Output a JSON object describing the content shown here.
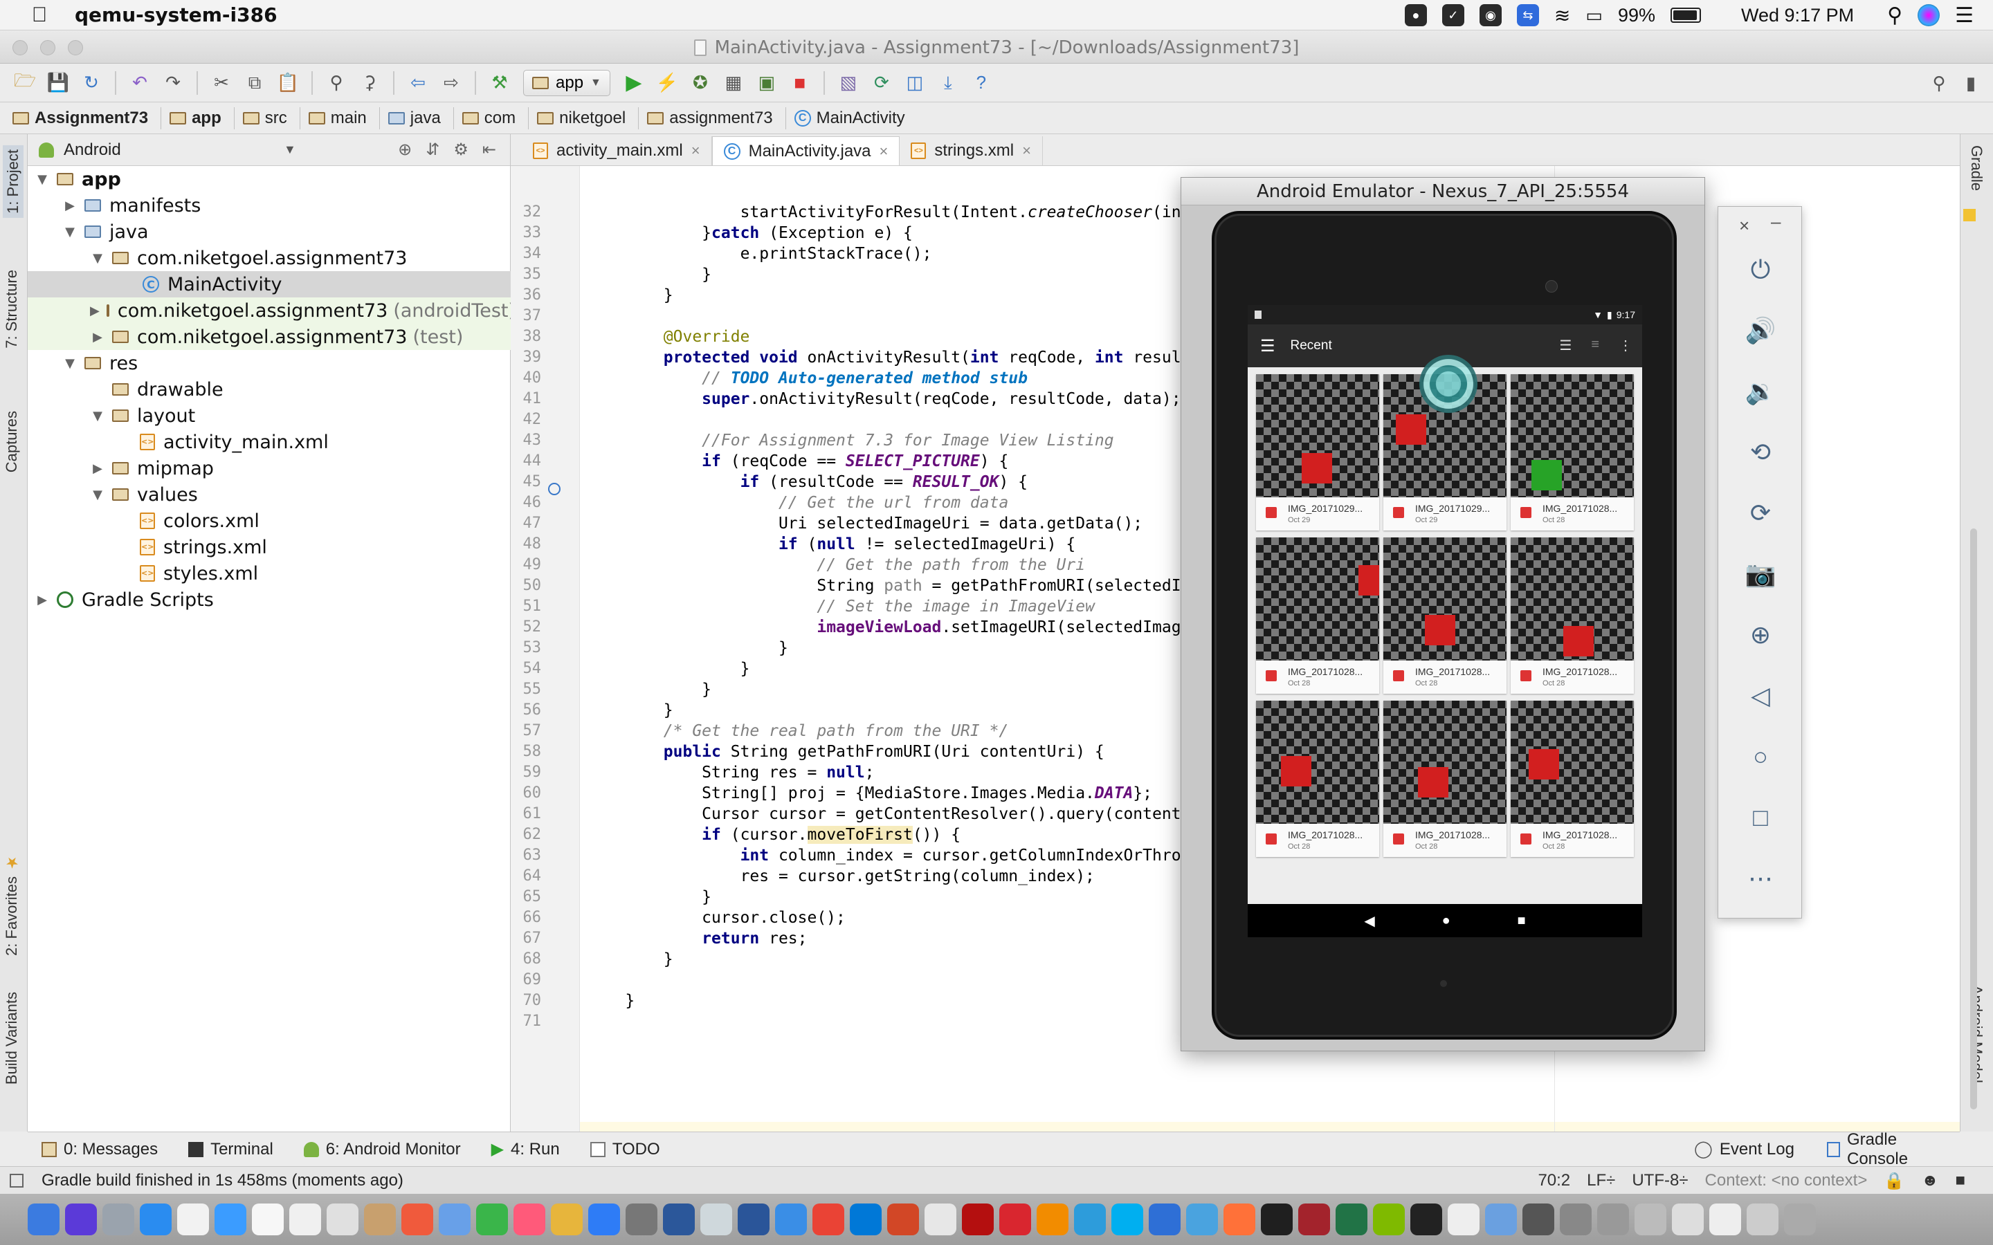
{
  "menubar": {
    "app_name": "qemu-system-i386",
    "battery": "99%",
    "clock": "Wed 9:17 PM"
  },
  "window": {
    "title": "MainActivity.java - Assignment73 - [~/Downloads/Assignment73]"
  },
  "toolbar": {
    "run_config": "app"
  },
  "breadcrumb": [
    "Assignment73",
    "app",
    "src",
    "main",
    "java",
    "com",
    "niketgoel",
    "assignment73",
    "MainActivity"
  ],
  "project": {
    "view": "Android",
    "tree": [
      {
        "label": "app",
        "suffix": ""
      },
      {
        "label": "manifests",
        "suffix": ""
      },
      {
        "label": "java",
        "suffix": ""
      },
      {
        "label": "com.niketgoel.assignment73",
        "suffix": ""
      },
      {
        "label": "MainActivity",
        "suffix": ""
      },
      {
        "label": "com.niketgoel.assignment73",
        "suffix": "(androidTest)"
      },
      {
        "label": "com.niketgoel.assignment73",
        "suffix": "(test)"
      },
      {
        "label": "res",
        "suffix": ""
      },
      {
        "label": "drawable",
        "suffix": ""
      },
      {
        "label": "layout",
        "suffix": ""
      },
      {
        "label": "activity_main.xml",
        "suffix": ""
      },
      {
        "label": "mipmap",
        "suffix": ""
      },
      {
        "label": "values",
        "suffix": ""
      },
      {
        "label": "colors.xml",
        "suffix": ""
      },
      {
        "label": "strings.xml",
        "suffix": ""
      },
      {
        "label": "styles.xml",
        "suffix": ""
      },
      {
        "label": "Gradle Scripts",
        "suffix": ""
      }
    ]
  },
  "tabs": [
    "activity_main.xml",
    "MainActivity.java",
    "strings.xml"
  ],
  "left_tool_tabs": [
    "1: Project",
    "7: Structure",
    "Captures",
    "2: Favorites",
    "Build Variants"
  ],
  "right_tool_tabs": [
    "Gradle",
    "Android Model"
  ],
  "code": {
    "line_numbers": [
      "32",
      "33",
      "34",
      "35",
      "36",
      "37",
      "38",
      "39",
      "40",
      "41",
      "42",
      "43",
      "44",
      "45",
      "46",
      "47",
      "48",
      "49",
      "50",
      "51",
      "52",
      "53",
      "54",
      "55",
      "56",
      "57",
      "58",
      "59",
      "60",
      "61",
      "62",
      "63",
      "64",
      "65",
      "66",
      "67",
      "68",
      "69",
      "70",
      "71"
    ],
    "l32": "startActivityForResult(Intent.",
    "l32b": "createChooser",
    "l32c": "(inte",
    "l33a": "}",
    "l33b": "catch",
    "l33c": " (Exception e) {",
    "l34": "e.printStackTrace();",
    "l35": "}",
    "l36": "}",
    "l38": "@Override",
    "l39a": "protected void",
    "l39b": " onActivityResult(",
    "l39c": "int",
    "l39d": " reqCode, ",
    "l39e": "int",
    "l39f": " resultC",
    "l40a": "// ",
    "l40b": "TODO Auto-generated method stub",
    "l41a": "super",
    "l41b": ".onActivityResult(reqCode, resultCode, data);",
    "l43": "//For Assignment 7.3 for Image View Listing",
    "l44a": "if",
    "l44b": " (reqCode == ",
    "l44c": "SELECT_PICTURE",
    "l44d": ") {",
    "l45a": "if",
    "l45b": " (resultCode == ",
    "l45c": "RESULT_OK",
    "l45d": ") {",
    "l46": "// Get the url from data",
    "l47": "Uri selectedImageUri = data.getData();",
    "l48a": "if",
    "l48b": " (",
    "l48c": "null",
    "l48d": " != selectedImageUri) {",
    "l49": "// Get the path from the Uri",
    "l50a": "String ",
    "l50b": "path",
    "l50c": " = getPathFromURI(selectedIma",
    "l51": "// Set the image in ImageView",
    "l52a": "imageViewLoad",
    "l52b": ".setImageURI(selectedImageU",
    "l53": "}",
    "l54": "}",
    "l55": "}",
    "l56": "}",
    "l57": "/* Get the real path from the URI */",
    "l58a": "public",
    "l58b": " String getPathFromURI(Uri contentUri) {",
    "l59a": "String res = ",
    "l59b": "null",
    "l59c": ";",
    "l60a": "String[] proj = {MediaStore.Images.Media.",
    "l60b": "DATA",
    "l60c": "};",
    "l61": "Cursor cursor = getContentResolver().query(contentUr",
    "l62a": "if",
    "l62b": " (cursor.",
    "l62c": "moveToFirst",
    "l62d": "()) {",
    "l63a": "int",
    "l63b": " column_index = cursor.getColumnIndexOrThrow(",
    "l64": "res = cursor.getString(column_index);",
    "l65": "}",
    "l66": "cursor.close();",
    "l67a": "return",
    "l67b": " res;",
    "l68": "}",
    "l70": "}"
  },
  "emulator": {
    "title": "Android Emulator - Nexus_7_API_25:5554",
    "status_time": "9:17",
    "app_title": "Recent",
    "photos": [
      {
        "name": "IMG_20171029...",
        "date": "Oct 29",
        "square": "red"
      },
      {
        "name": "IMG_20171029...",
        "date": "Oct 29",
        "square": "red"
      },
      {
        "name": "IMG_20171028...",
        "date": "Oct 28",
        "square": "green"
      },
      {
        "name": "IMG_20171028...",
        "date": "Oct 28",
        "square": "red"
      },
      {
        "name": "IMG_20171028...",
        "date": "Oct 28",
        "square": "red"
      },
      {
        "name": "IMG_20171028...",
        "date": "Oct 28",
        "square": "red"
      },
      {
        "name": "IMG_20171028...",
        "date": "Oct 28",
        "square": "red"
      },
      {
        "name": "IMG_20171028...",
        "date": "Oct 28",
        "square": "red"
      },
      {
        "name": "IMG_20171028...",
        "date": "Oct 28",
        "square": "red"
      }
    ]
  },
  "bottom_tabs": {
    "messages": "0: Messages",
    "terminal": "Terminal",
    "monitor": "6: Android Monitor",
    "run": "4: Run",
    "todo": "TODO",
    "event_log": "Event Log",
    "gradle_console": "Gradle Console"
  },
  "status": {
    "message": "Gradle build finished in 1s 458ms (moments ago)",
    "position": "70:2",
    "line_sep": "LF÷",
    "encoding": "UTF-8÷",
    "context": "Context: <no context>"
  }
}
